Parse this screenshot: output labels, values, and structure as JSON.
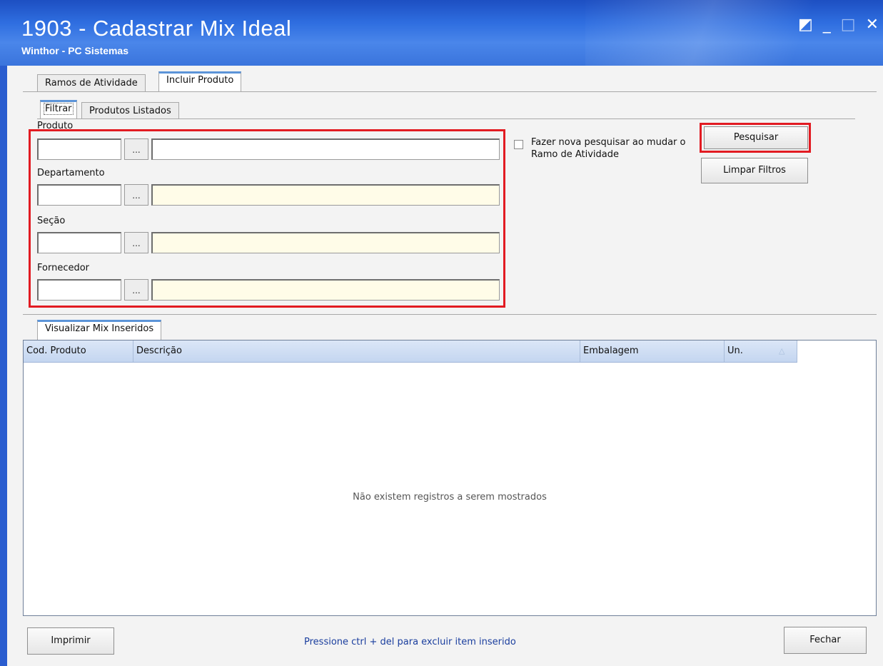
{
  "window": {
    "title": "1903 - Cadastrar Mix Ideal",
    "subtitle": "Winthor - PC Sistemas",
    "controls": {
      "restore": "◩",
      "minimize": "_",
      "maximize": "□",
      "close": "✕"
    }
  },
  "tabs": {
    "outer": [
      {
        "label": "Ramos de Atividade",
        "active": false
      },
      {
        "label": "Incluir Produto",
        "active": true
      }
    ],
    "inner": [
      {
        "label": "Filtrar",
        "active": true
      },
      {
        "label": "Produtos Listados",
        "active": false
      }
    ]
  },
  "filters": {
    "produto": {
      "label": "Produto",
      "code": "",
      "description": ""
    },
    "departamento": {
      "label": "Departamento",
      "code": "",
      "description": ""
    },
    "secao": {
      "label": "Seção",
      "code": "",
      "description": ""
    },
    "fornecedor": {
      "label": "Fornecedor",
      "code": "",
      "description": ""
    },
    "lookup_label": "..."
  },
  "options": {
    "nova_pesquisa_label": "Fazer nova pesquisar ao mudar o Ramo de Atividade",
    "nova_pesquisa_checked": false
  },
  "buttons": {
    "pesquisar": "Pesquisar",
    "limpar": "Limpar Filtros",
    "imprimir": "Imprimir",
    "fechar": "Fechar"
  },
  "grid": {
    "tab_label": "Visualizar Mix Inseridos",
    "columns": [
      "Cod. Produto",
      "Descrição",
      "Embalagem",
      "Un."
    ],
    "empty_message": "Não existem registros a serem mostrados",
    "rows": []
  },
  "footer": {
    "hint": "Pressione ctrl + del  para excluir item inserido"
  },
  "colors": {
    "titlebar": "#2f6ee0",
    "highlight": "#e21b22",
    "lookup_field": "#fffce8",
    "grid_header": "#c4d6f0"
  }
}
